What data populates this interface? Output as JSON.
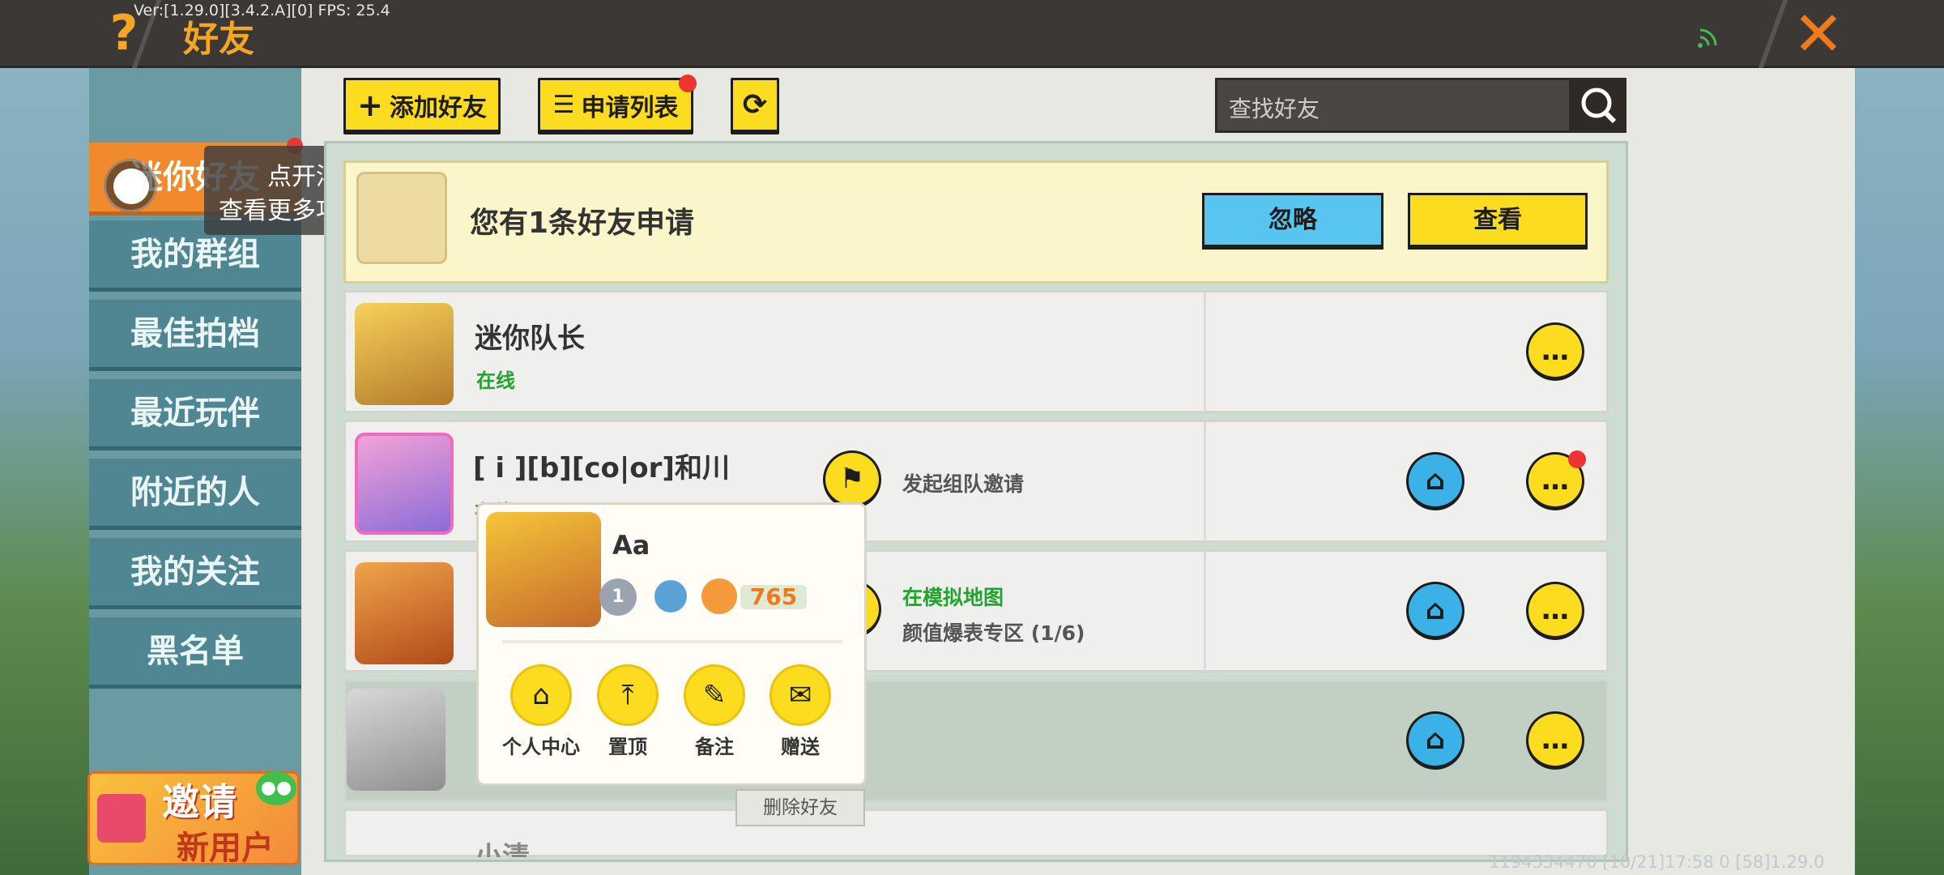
{
  "header": {
    "version": "Ver:[1.29.0][3.4.2.A][0] FPS: 25.4",
    "title": "好友"
  },
  "sidebar": {
    "items": [
      {
        "label": "迷你好友",
        "selected": true
      },
      {
        "label": "我的群组"
      },
      {
        "label": "最佳拍档"
      },
      {
        "label": "最近玩伴"
      },
      {
        "label": "附近的人"
      },
      {
        "label": "我的关注"
      },
      {
        "label": "黑名单"
      }
    ]
  },
  "float_tip": {
    "line1": "点开浮球",
    "line2": "查看更多功能哦"
  },
  "invite": {
    "line1": "邀请",
    "line2": "新用户"
  },
  "toolbar": {
    "add_friend": "添加好友",
    "apply_list": "申请列表",
    "search_placeholder": "查找好友"
  },
  "request": {
    "text": "您有1条好友申请",
    "ignore": "忽略",
    "view": "查看"
  },
  "friends": [
    {
      "name": "迷你队长",
      "status": "在线"
    },
    {
      "name": "[ i ][b][co|or]和川",
      "status": "在线",
      "action": "发起组队邀请"
    },
    {
      "status_map": "在模拟地图",
      "room": "颜值爆表专区 (1/6)"
    },
    {},
    {
      "name": "小清"
    }
  ],
  "popup": {
    "name": "Aa",
    "level": "1",
    "score": "765",
    "actions": [
      "个人中心",
      "置顶",
      "备注",
      "赠送"
    ],
    "delete": "删除好友"
  },
  "footer": "1194334470  [10/21]17:58 0  [58]1.29.0",
  "colors": {
    "accent_yellow": "#fcdc1f",
    "accent_blue": "#3ab2e8",
    "title_orange": "#f5a623"
  }
}
